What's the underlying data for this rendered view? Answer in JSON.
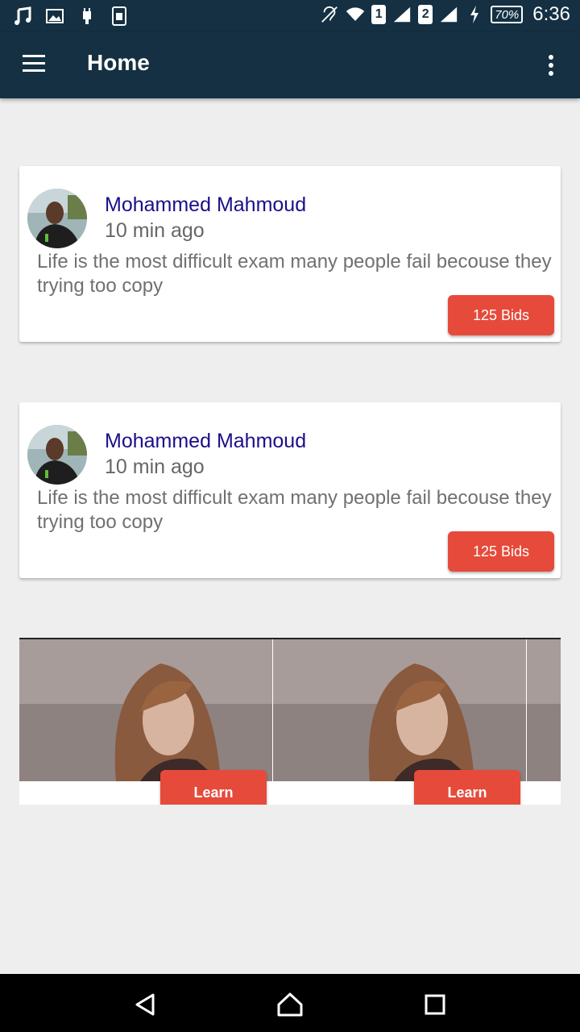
{
  "status_bar": {
    "sim1": "1",
    "sim2": "2",
    "battery": "70%",
    "time": "6:36"
  },
  "app_bar": {
    "title": "Home"
  },
  "posts": [
    {
      "author": "Mohammed Mahmoud",
      "time_ago": "10 min ago",
      "text": "Life is the most difficult exam many people fail becouse they trying too copy",
      "bids_label": "125 Bids"
    },
    {
      "author": "Mohammed Mahmoud",
      "time_ago": "10 min ago",
      "text": "Life is the most difficult exam many people fail becouse they trying too copy",
      "bids_label": "125 Bids"
    }
  ],
  "carousel": {
    "items": [
      {
        "button_label": "Learn"
      },
      {
        "button_label": "Learn"
      }
    ]
  },
  "colors": {
    "primary": "#143042",
    "accent": "#e64a3b",
    "author_name": "#1a0f8a"
  },
  "icons": [
    "music-icon",
    "image-icon",
    "usb-icon",
    "sim-card-icon",
    "hearing-aid-icon",
    "wifi-icon",
    "signal-icon",
    "charging-icon",
    "menu-icon",
    "more-vert-icon",
    "back-icon",
    "home-icon",
    "recents-icon"
  ]
}
